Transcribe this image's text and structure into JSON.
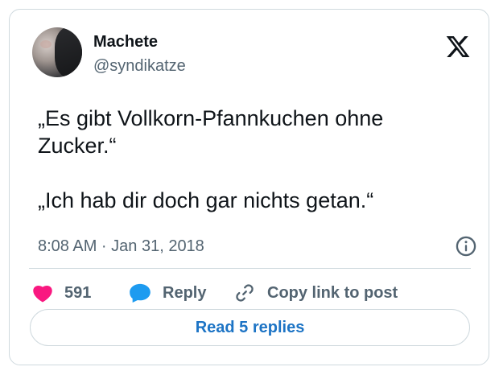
{
  "author": {
    "name": "Machete",
    "handle": "@syndikatze"
  },
  "tweet": {
    "text": "„Es gibt Vollkorn-Pfannkuchen ohne\nZucker.“\n\n„Ich hab dir doch gar nichts getan.“",
    "timestamp": "8:08 AM · Jan 31, 2018"
  },
  "actions": {
    "like_count": "591",
    "reply_label": "Reply",
    "copy_label": "Copy link to post"
  },
  "read_replies_label": "Read 5 replies",
  "colors": {
    "like": "#f91880",
    "reply": "#1d9bf0",
    "link": "#1d74c5",
    "muted": "#536471",
    "border": "#cfd9de"
  },
  "icons": [
    "x-logo-icon",
    "info-icon",
    "heart-icon",
    "reply-bubble-icon",
    "link-icon"
  ]
}
